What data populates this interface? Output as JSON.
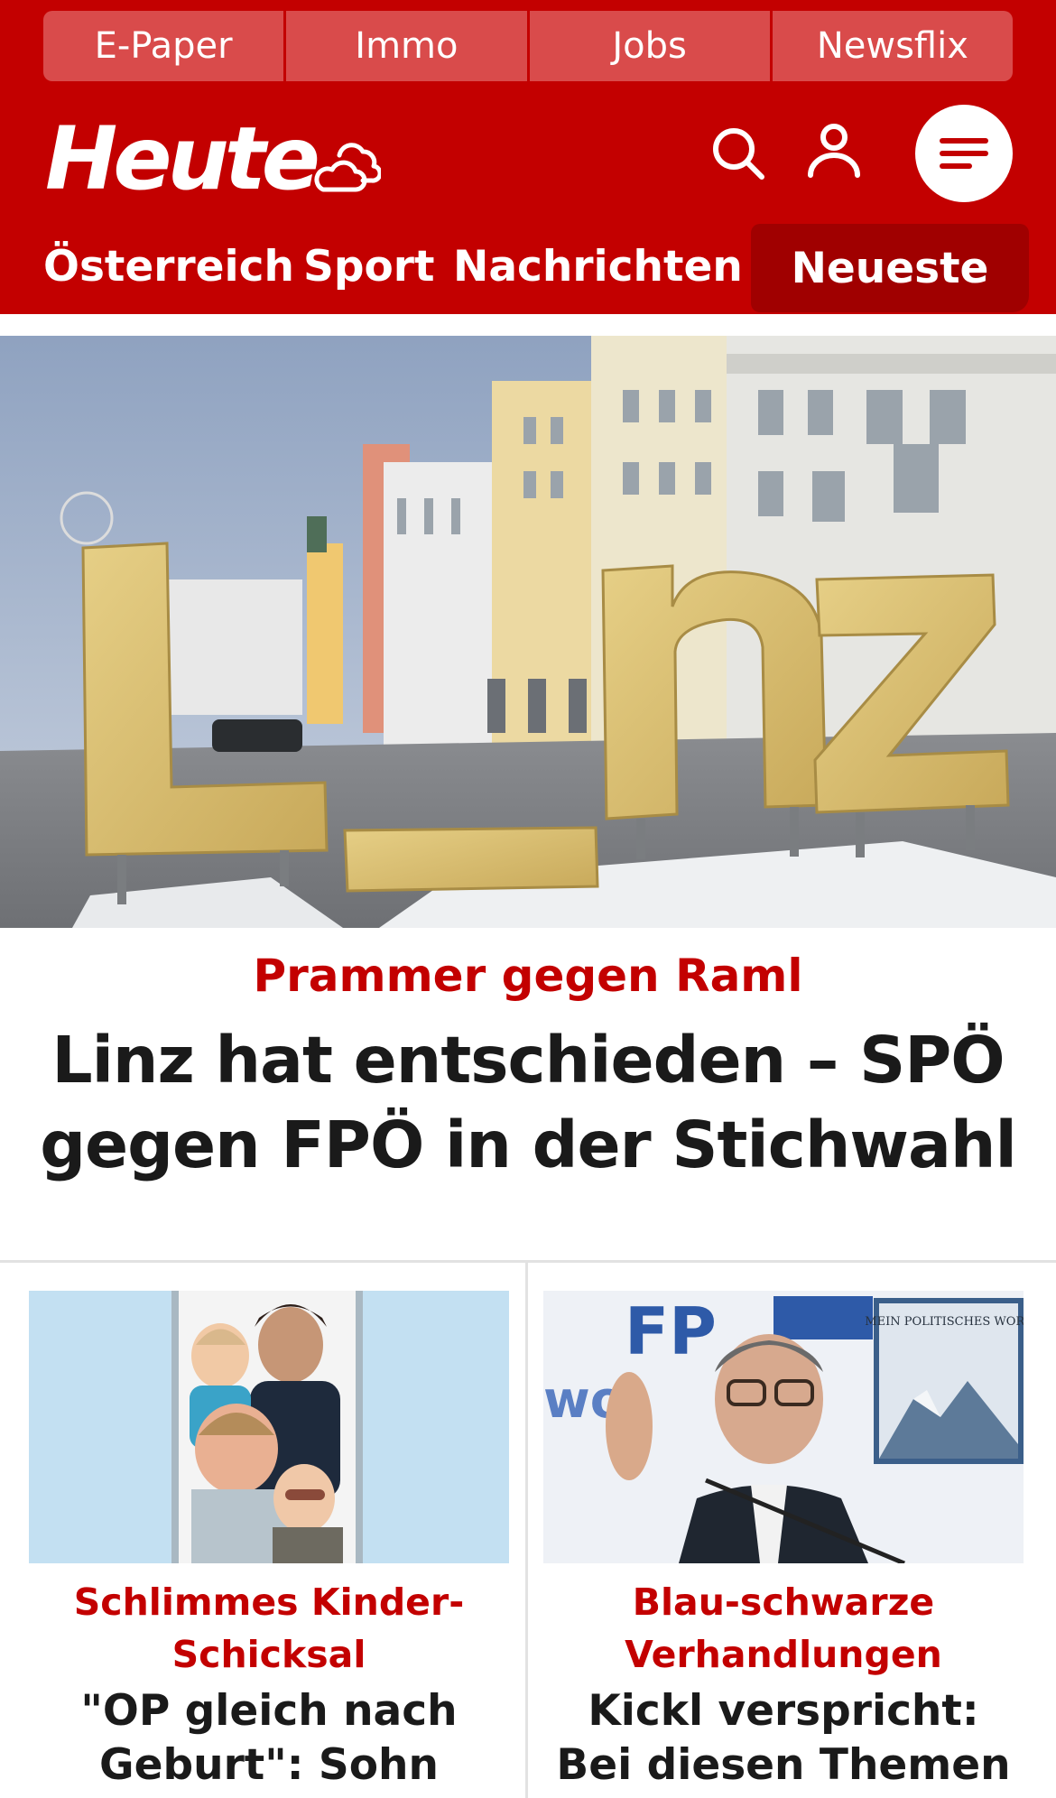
{
  "colors": {
    "brand_red": "#c30000",
    "nav_active": "#a00000",
    "top_link_bg": "#d94b4b",
    "divider": "#e2e2e2"
  },
  "top_links": [
    "E-Paper",
    "Immo",
    "Jobs",
    "Newsflix"
  ],
  "header": {
    "logo": "Heute",
    "weather_icon": "cloud-sun-icon",
    "search_icon": "search-icon",
    "account_icon": "user-icon",
    "menu_icon": "hamburger-icon"
  },
  "nav": {
    "items": [
      "Österreich",
      "Sport",
      "Nachrichten"
    ],
    "active": "Neueste"
  },
  "hero": {
    "image": "Linz letters sculpture on snowy main square",
    "kicker": "Prammer gegen Raml",
    "title": "Linz hat entschieden – SPÖ gegen FPÖ in der Stichwahl"
  },
  "cards": [
    {
      "image": "family portrait photo",
      "kicker": "Schlimmes Kinder-Schicksal",
      "title": "\"OP gleich nach Geburt\": Sohn wurde"
    },
    {
      "image": "Herbert Kickl at press conference",
      "kicker": "Blau-schwarze Verhandlungen",
      "title": "Kickl verspricht: Bei diesen Themen ändert"
    }
  ],
  "card_image_texts": {
    "poster_title": "MEIN POLITISCHES WORT"
  }
}
